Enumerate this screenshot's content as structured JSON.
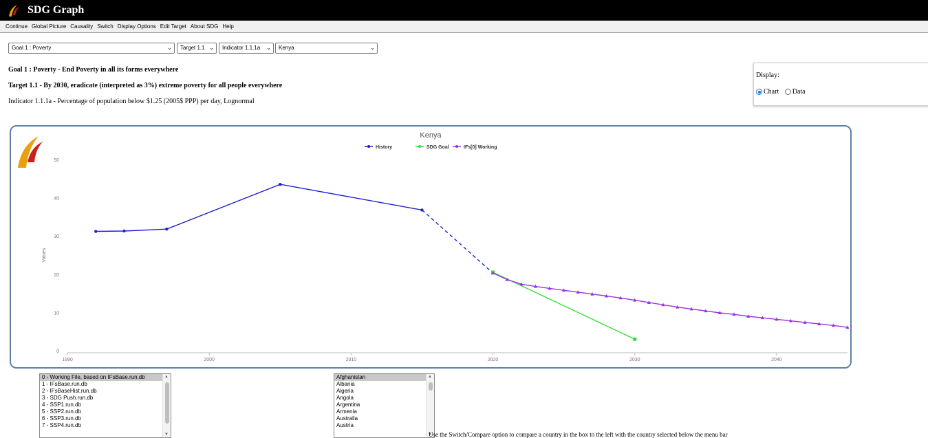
{
  "app": {
    "title": "SDG Graph",
    "colors": {
      "titlebar": "#000000",
      "accent": "#1a73e8"
    }
  },
  "menu": [
    "Continue",
    "Global Picture",
    "Causality",
    "Switch",
    "Display Options",
    "Edit Target",
    "About SDG",
    "Help"
  ],
  "selectors": {
    "goal": "Goal 1 : Poverty",
    "target": "Target 1.1",
    "indicator": "Indicator 1.1.1a",
    "country": "Kenya"
  },
  "headings": {
    "goal": "Goal 1 : Poverty - End Poverty in all its forms everywhere",
    "target": "Target 1.1 - By 2030, eradicate (interpreted as 3%) extreme poverty for all people everywhere",
    "indicator": "Indicator 1.1.1a - Percentage of population below $1.25 (2005$ PPP) per day, Lognormal"
  },
  "display": {
    "label": "Display:",
    "options": [
      "Chart",
      "Data"
    ],
    "selected": "Chart"
  },
  "chart_data": {
    "type": "line",
    "title": "Kenya",
    "xlabel": "",
    "ylabel": "Values",
    "xlim": [
      1990,
      2045
    ],
    "ylim": [
      0,
      50
    ],
    "x_ticks": [
      1990,
      2000,
      2010,
      2020,
      2030,
      2040
    ],
    "y_ticks": [
      0,
      10,
      20,
      30,
      40,
      50
    ],
    "grid": false,
    "legend": "top-center",
    "series": [
      {
        "name": "History",
        "color": "#1f1fd4",
        "marker": "circle",
        "x": [
          1992,
          1994,
          1997,
          2005,
          2015
        ],
        "y": [
          31.2,
          31.3,
          31.8,
          43.5,
          36.8
        ]
      },
      {
        "name": "History",
        "legend": false,
        "color": "#1f1fd4",
        "style": "dashed",
        "x": [
          2015,
          2020
        ],
        "y": [
          36.8,
          20.3
        ]
      },
      {
        "name": "SDG Goal",
        "color": "#33e033",
        "marker": "square",
        "x": [
          2020,
          2030
        ],
        "y": [
          20.5,
          3.0
        ]
      },
      {
        "name": "IFs[0] Working",
        "color": "#9a33e0",
        "marker": "triangle",
        "x": [
          2020,
          2021,
          2022,
          2023,
          2024,
          2025,
          2026,
          2027,
          2028,
          2029,
          2030,
          2031,
          2032,
          2033,
          2034,
          2035,
          2036,
          2037,
          2038,
          2039,
          2040,
          2041,
          2042,
          2043,
          2044,
          2045
        ],
        "y": [
          20.3,
          18.6,
          17.4,
          16.8,
          16.3,
          15.8,
          15.3,
          14.8,
          14.3,
          13.8,
          13.2,
          12.6,
          12.0,
          11.4,
          10.9,
          10.4,
          9.9,
          9.5,
          9.0,
          8.6,
          8.2,
          7.8,
          7.4,
          7.0,
          6.6,
          6.1
        ]
      }
    ]
  },
  "run_files": [
    "0 - Working File, based on IFsBase.run.db",
    "1 - IFsBase.run.db",
    "2 - IFsBaseHist.run.db",
    "3 - SDG Push.run.db",
    "4 - SSP1.run.db",
    "5 - SSP2.run.db",
    "6 - SSP3.run.db",
    "7 - SSP4.run.db"
  ],
  "countries": [
    "Afghanistan",
    "Albania",
    "Algeria",
    "Angola",
    "Argentina",
    "Armenia",
    "Australia",
    "Austria"
  ],
  "hint": "Use the Switch/Compare option to compare a country in the box to the left with the country selected below the menu bar"
}
